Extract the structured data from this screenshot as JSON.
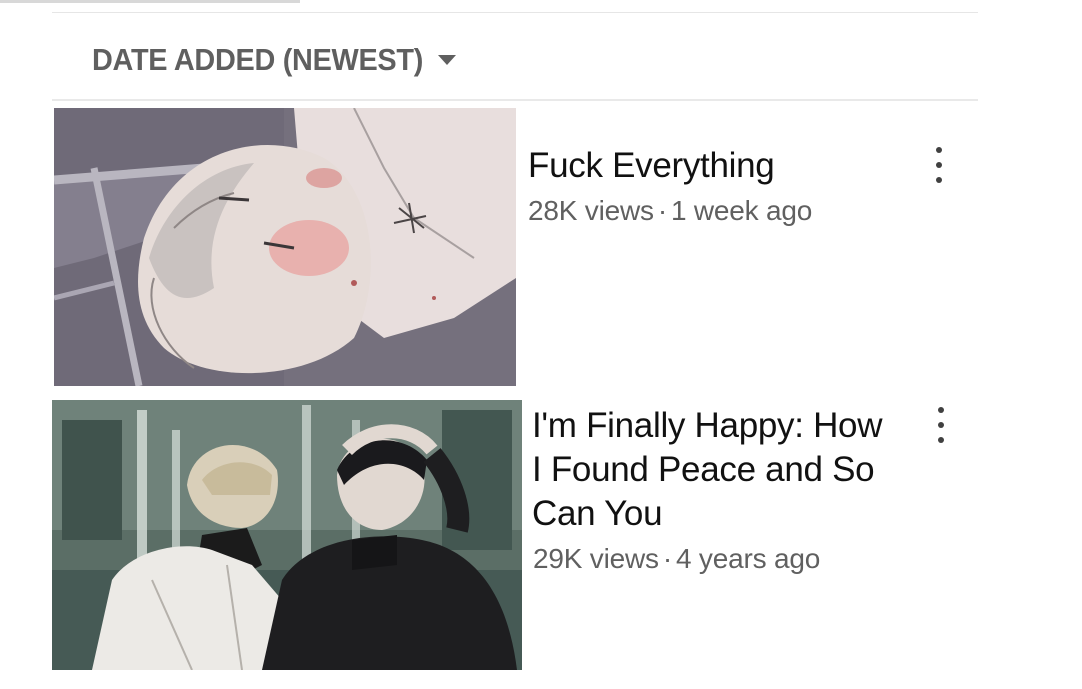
{
  "sort": {
    "label": "DATE ADDED (NEWEST)",
    "icon": "caret-down-icon"
  },
  "videos": [
    {
      "title": "Fuck Everything",
      "views": "28K views",
      "separator": "·",
      "age": "1 week ago",
      "menu_icon": "more-vert-icon"
    },
    {
      "title": "I'm Finally Happy: How I Found Peace and So Can You",
      "views": "29K views",
      "separator": "·",
      "age": "4 years ago",
      "menu_icon": "more-vert-icon"
    }
  ]
}
